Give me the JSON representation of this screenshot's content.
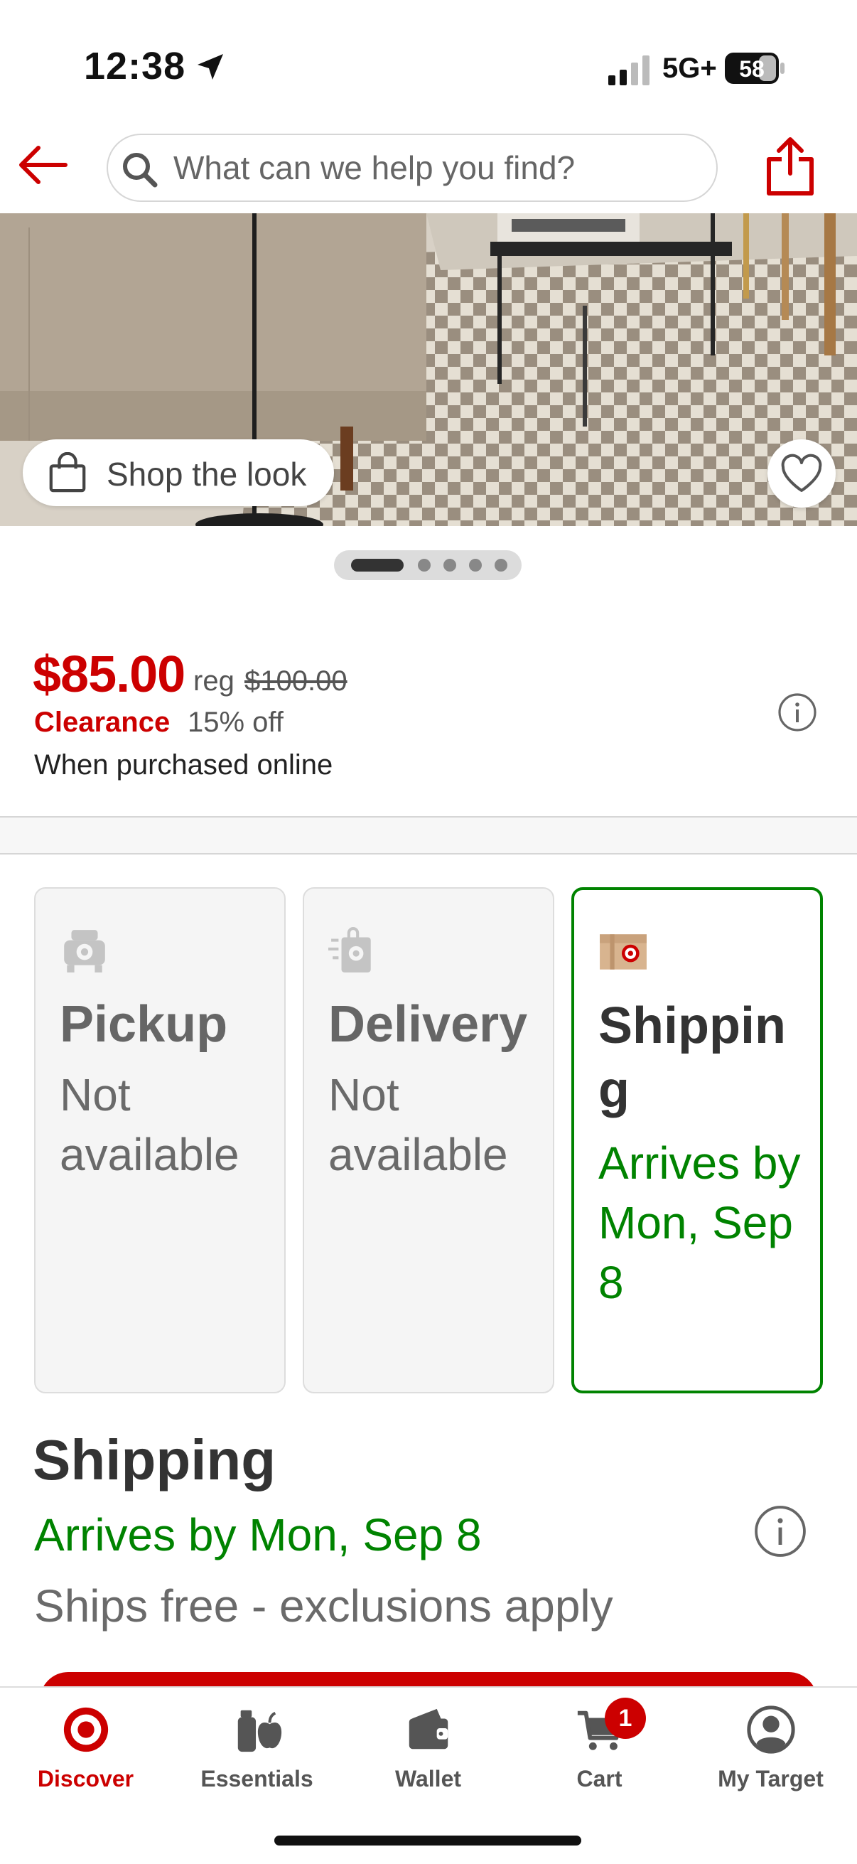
{
  "status_bar": {
    "time": "12:38",
    "network": "5G+",
    "battery": "58",
    "icons": [
      "location-arrow-icon",
      "signal-icon",
      "battery-icon"
    ]
  },
  "header": {
    "search_placeholder": "What can we help you find?",
    "icons": [
      "back-arrow-icon",
      "search-icon",
      "share-icon"
    ]
  },
  "hero": {
    "shop_the_look_label": "Shop the look",
    "carousel_total": 5,
    "carousel_active": 1,
    "icons": [
      "shopping-bag-icon",
      "heart-icon"
    ]
  },
  "price": {
    "current": "$85.00",
    "reg_label": "reg",
    "reg_price": "$100.00",
    "clearance_label": "Clearance",
    "discount": "15% off",
    "note": "When purchased online",
    "icon": "info-icon"
  },
  "fulfillment": {
    "options": [
      {
        "title": "Pickup",
        "status": "Not available",
        "state": "disabled",
        "icon": "pickup-car-icon"
      },
      {
        "title": "Delivery",
        "status": "Not available",
        "state": "disabled",
        "icon": "delivery-bag-icon"
      },
      {
        "title": "Shipping",
        "status": "Arrives by Mon, Sep 8",
        "state": "selected",
        "icon": "shipping-box-icon"
      }
    ]
  },
  "shipping": {
    "title": "Shipping",
    "arrival": "Arrives by Mon, Sep 8",
    "cost_note": "Ships free - exclusions apply",
    "icon": "info-icon"
  },
  "tabbar": {
    "tabs": [
      {
        "label": "Discover",
        "icon": "target-bullseye-icon",
        "active": true
      },
      {
        "label": "Essentials",
        "icon": "essentials-icon",
        "active": false
      },
      {
        "label": "Wallet",
        "icon": "wallet-icon",
        "active": false
      },
      {
        "label": "Cart",
        "icon": "cart-icon",
        "active": false,
        "badge": "1"
      },
      {
        "label": "My Target",
        "icon": "account-icon",
        "active": false
      }
    ]
  },
  "colors": {
    "brand_red": "#cc0000",
    "success_green": "#008300",
    "text_dark": "#333333",
    "text_muted": "#666666"
  }
}
